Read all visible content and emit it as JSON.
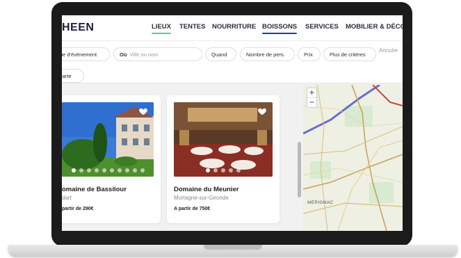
{
  "brand": {
    "logo": "HEEN"
  },
  "nav": {
    "items": [
      {
        "label": "LIEUX",
        "active": true,
        "underline": "#5cc4a6"
      },
      {
        "label": "TENTES"
      },
      {
        "label": "NOURRITURE"
      },
      {
        "label": "BOISSONS",
        "active": true,
        "underline": "#2b3a8c"
      },
      {
        "label": "SERVICES"
      },
      {
        "label": "MOBILIER & DÉCO"
      }
    ]
  },
  "filters": {
    "event_type": "pe d'évènement",
    "where_label": "Où",
    "where_placeholder": "Ville ou nom",
    "when": "Quand",
    "people": "Nombre de pers.",
    "price": "Prix",
    "more": "Plus de critères",
    "cancel": "Annuler",
    "map_toggle": "carte"
  },
  "cards": [
    {
      "title": "omaine de Bassilour",
      "location": "dart",
      "price": "partir de 290€"
    },
    {
      "title": "Domaine du Meunier",
      "location": "Mortagne-sur-Gironde",
      "price": "A partir de 750€"
    }
  ],
  "map": {
    "zoom_in": "+",
    "zoom_out": "−",
    "place_label": "MÉRIGNAC"
  },
  "colors": {
    "accent_green": "#5cc4a6",
    "accent_navy": "#2b3a8c",
    "text_dark": "#2b2b3d"
  }
}
